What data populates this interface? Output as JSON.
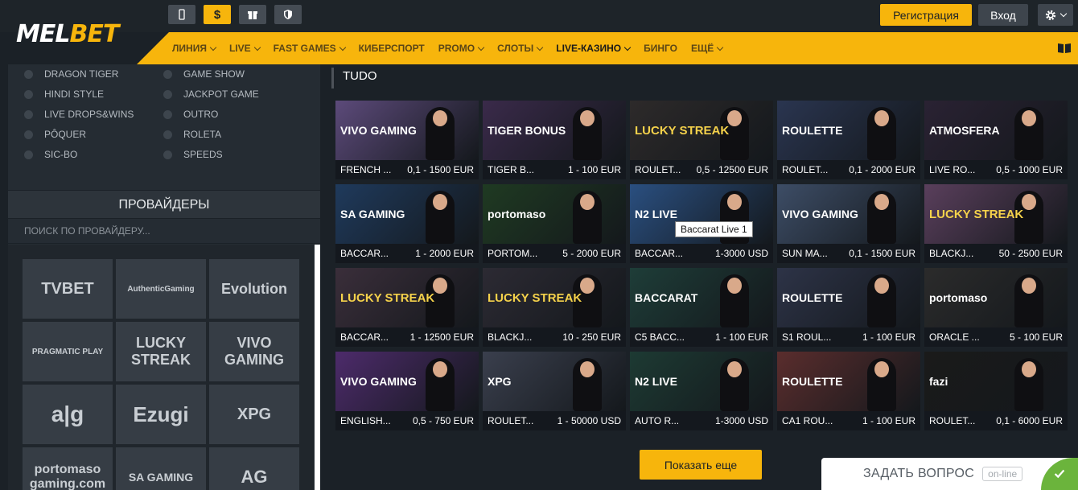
{
  "header": {
    "logo_mel": "MEL",
    "logo_bet": "BET",
    "money_icon": "$",
    "register_label": "Регистрация",
    "login_label": "Вход"
  },
  "nav": {
    "items": [
      {
        "label": "ЛИНИЯ",
        "dropdown": true
      },
      {
        "label": "LIVE",
        "dropdown": true
      },
      {
        "label": "FAST GAMES",
        "dropdown": true
      },
      {
        "label": "КИБЕРСПОРТ",
        "dropdown": false
      },
      {
        "label": "PROMO",
        "dropdown": true
      },
      {
        "label": "СЛОТЫ",
        "dropdown": true
      },
      {
        "label": "LIVE-КАЗИНО",
        "dropdown": true,
        "active": true
      },
      {
        "label": "БИНГО",
        "dropdown": false
      },
      {
        "label": "ЕЩЁ",
        "dropdown": true
      }
    ]
  },
  "sidebar": {
    "categories_left": [
      "DRAGON TIGER",
      "HINDI STYLE",
      "LIVE DROPS&WINS",
      "PÔQUER",
      "SIC-BO"
    ],
    "categories_right": [
      "GAME SHOW",
      "JACKPOT GAME",
      "OUTRO",
      "ROLETA",
      "SPEEDS"
    ],
    "providers_title": "ПРОВАЙДЕРЫ",
    "search_placeholder": "ПОИСК ПО ПРОВАЙДЕРУ...",
    "providers": [
      "TVBET",
      "AuthenticGaming",
      "Evolution",
      "PRAGMATIC PLAY",
      "LUCKY STREAK",
      "VIVO GAMING",
      "a|g",
      "Ezugi",
      "XPG",
      "portomaso gaming.com",
      "SA GAMING",
      "AG"
    ]
  },
  "main": {
    "title": "TUDO",
    "tooltip": "Baccarat Live 1",
    "more_label": "Показать еще",
    "games": [
      {
        "name": "FRENCH ...",
        "limits": "0,1 - 1500 EUR",
        "logo": "VIVO GAMING",
        "color": "#5c4a7a"
      },
      {
        "name": "TIGER B...",
        "limits": "1 - 100 EUR",
        "logo": "TIGER BONUS",
        "color": "#3a2a4a"
      },
      {
        "name": "ROULET...",
        "limits": "0,5 - 12500 EUR",
        "logo": "LUCKY STREAK",
        "color": "#2d2a2a"
      },
      {
        "name": "ROULET...",
        "limits": "0,1 - 2000 EUR",
        "logo": "ROULETTE",
        "color": "#2a3550"
      },
      {
        "name": "LIVE RO...",
        "limits": "0,5 - 1000 EUR",
        "logo": "ATMOSFERA",
        "color": "#2a2233"
      },
      {
        "name": "BACCAR...",
        "limits": "1 - 2000 EUR",
        "logo": "SA GAMING",
        "color": "#1f3a5c"
      },
      {
        "name": "PORTOM...",
        "limits": "5 - 2000 EUR",
        "logo": "portomaso",
        "color": "#1f3a22"
      },
      {
        "name": "BACCAR...",
        "limits": "1-3000 USD",
        "logo": "N2 LIVE",
        "color": "#2a4f80"
      },
      {
        "name": "SUN MA...",
        "limits": "0,1 - 1500 EUR",
        "logo": "VIVO GAMING",
        "color": "#3d4d66"
      },
      {
        "name": "BLACKJ...",
        "limits": "50 - 2500 EUR",
        "logo": "LUCKY STREAK",
        "color": "#5a3f5c"
      },
      {
        "name": "BACCAR...",
        "limits": "1 - 12500 EUR",
        "logo": "LUCKY STREAK",
        "color": "#3a2e3a"
      },
      {
        "name": "BLACKJ...",
        "limits": "10 - 250 EUR",
        "logo": "LUCKY STREAK",
        "color": "#2c2a33"
      },
      {
        "name": "C5 BACC...",
        "limits": "1 - 100 EUR",
        "logo": "BACCARAT",
        "color": "#1e3d38"
      },
      {
        "name": "S1 ROUL...",
        "limits": "1 - 100 EUR",
        "logo": "ROULETTE",
        "color": "#2d3347"
      },
      {
        "name": "ORACLE ...",
        "limits": "5 - 100 EUR",
        "logo": "portomaso",
        "color": "#2b2b2b"
      },
      {
        "name": "ENGLISH...",
        "limits": "0,5 - 750 EUR",
        "logo": "VIVO GAMING",
        "color": "#4d2b6b"
      },
      {
        "name": "ROULET...",
        "limits": "1 - 50000 USD",
        "logo": "XPG",
        "color": "#3a3f4d"
      },
      {
        "name": "AUTO R...",
        "limits": "1-3000 USD",
        "logo": "N2 LIVE",
        "color": "#1d3a33"
      },
      {
        "name": "CA1 ROU...",
        "limits": "1 - 100 EUR",
        "logo": "ROULETTE",
        "color": "#5a2d2d"
      },
      {
        "name": "ROULET...",
        "limits": "0,1 - 6000 EUR",
        "logo": "fazi",
        "color": "#1a1a1a"
      }
    ]
  },
  "chat": {
    "text": "ЗАДАТЬ ВОПРОС",
    "status": "on-line"
  },
  "colors": {
    "accent": "#f7b50c",
    "background": "#1b2127",
    "panel": "#252c33",
    "chat_green": "#6bb43c"
  }
}
